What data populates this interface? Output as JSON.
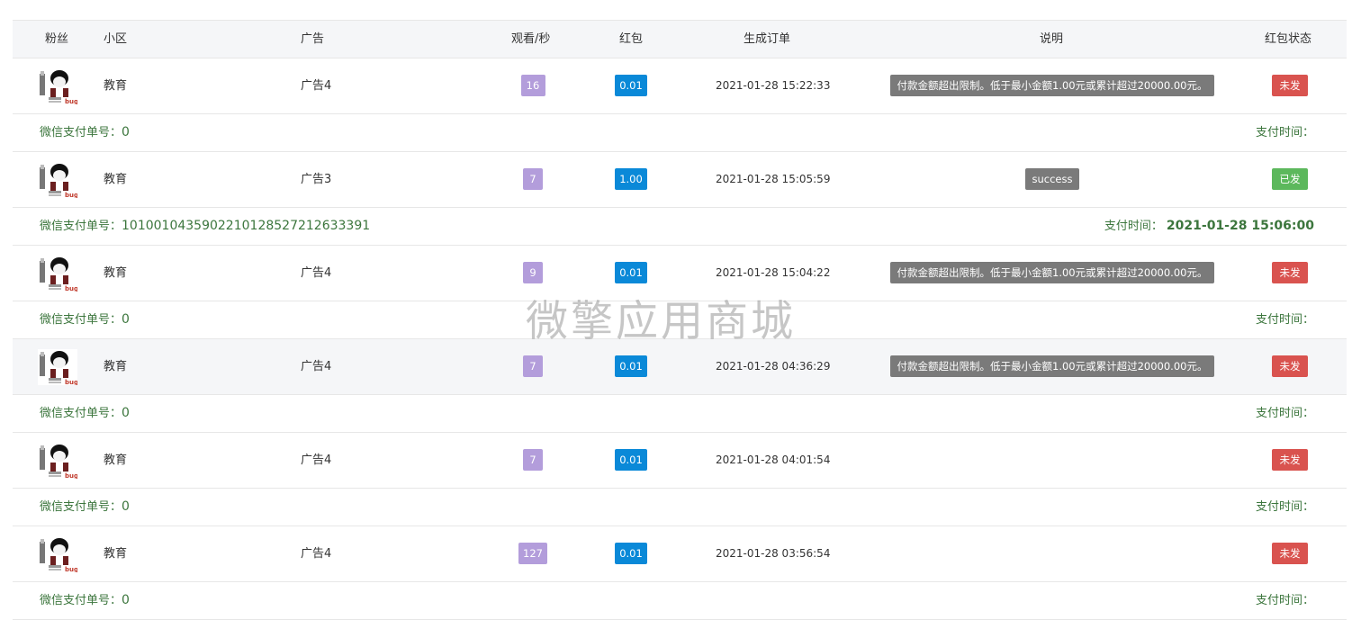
{
  "headers": {
    "fans": "粉丝",
    "community": "小区",
    "ad": "广告",
    "views": "观看/秒",
    "red_packet": "红包",
    "order_time": "生成订单",
    "note": "说明",
    "status": "红包状态"
  },
  "wx_label": "微信支付单号：",
  "pay_label": "支付时间：",
  "rows": [
    {
      "community": "教育",
      "ad": "广告4",
      "views": "16",
      "red_packet": "0.01",
      "order_time": "2021-01-28 15:22:33",
      "note": "付款金额超出限制。低于最小金额1.00元或累计超过20000.00元。",
      "status": "未发",
      "wx_no": "0",
      "pay_time": ""
    },
    {
      "community": "教育",
      "ad": "广告3",
      "views": "7",
      "red_packet": "1.00",
      "order_time": "2021-01-28 15:05:59",
      "note": "success",
      "status": "已发",
      "wx_no": "1010010435902210128527212633391",
      "pay_time": "2021-01-28 15:06:00"
    },
    {
      "community": "教育",
      "ad": "广告4",
      "views": "9",
      "red_packet": "0.01",
      "order_time": "2021-01-28 15:04:22",
      "note": "付款金额超出限制。低于最小金额1.00元或累计超过20000.00元。",
      "status": "未发",
      "wx_no": "0",
      "pay_time": ""
    },
    {
      "community": "教育",
      "ad": "广告4",
      "views": "7",
      "red_packet": "0.01",
      "order_time": "2021-01-28 04:36:29",
      "note": "付款金额超出限制。低于最小金额1.00元或累计超过20000.00元。",
      "status": "未发",
      "wx_no": "0",
      "pay_time": ""
    },
    {
      "community": "教育",
      "ad": "广告4",
      "views": "7",
      "red_packet": "0.01",
      "order_time": "2021-01-28 04:01:54",
      "note": "",
      "status": "未发",
      "wx_no": "0",
      "pay_time": ""
    },
    {
      "community": "教育",
      "ad": "广告4",
      "views": "127",
      "red_packet": "0.01",
      "order_time": "2021-01-28 03:56:54",
      "note": "",
      "status": "未发",
      "wx_no": "0",
      "pay_time": ""
    }
  ],
  "watermark": "微擎应用商城",
  "colors": {
    "views_badge": "#b39ddb",
    "red_packet_badge": "#0a89d8",
    "note_badge": "#7a7a7a",
    "status_not_sent": "#d9534f",
    "status_sent": "#5cb85c",
    "sub_text": "#3c763d",
    "header_bg": "#f5f6f8"
  }
}
